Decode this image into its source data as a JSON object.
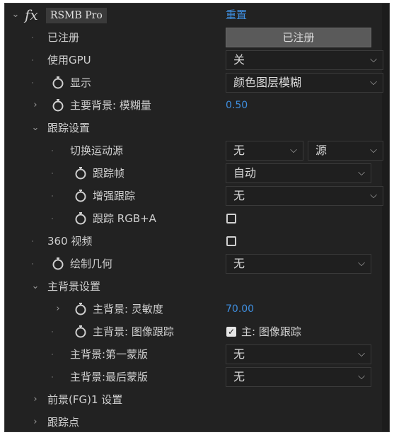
{
  "header": {
    "fx": "fx",
    "effect_name": "RSMB Pro",
    "reset_label": "重置"
  },
  "rows": {
    "registered": {
      "label": "已注册",
      "button": "已注册"
    },
    "use_gpu": {
      "label": "使用GPU",
      "value": "关"
    },
    "display": {
      "label": "显示",
      "value": "颜色图层模糊"
    },
    "main_bg_blur": {
      "label": "主要背景: 模糊量",
      "value": "0.50"
    },
    "tracking_settings": {
      "label": "跟踪设置"
    },
    "switch_motion_source": {
      "label": "切换运动源",
      "value1": "无",
      "value2": "源"
    },
    "tracking_frames": {
      "label": "跟踪帧",
      "value": "自动"
    },
    "enhance_tracking": {
      "label": "增强跟踪",
      "value": "无"
    },
    "track_rgba": {
      "label": "跟踪 RGB+A"
    },
    "video360": {
      "label": "360 视频"
    },
    "draw_geometry": {
      "label": "绘制几何",
      "value": "无"
    },
    "main_bg_settings": {
      "label": "主背景设置"
    },
    "main_bg_sensitivity": {
      "label": "主背景: 灵敏度",
      "value": "70.00"
    },
    "main_bg_image_tracking": {
      "label": "主背景: 图像跟踪",
      "checkbox_label": "主: 图像跟踪"
    },
    "main_bg_first_matte": {
      "label": "主背景:第一蒙版",
      "value": "无"
    },
    "main_bg_last_matte": {
      "label": "主背景:最后蒙版",
      "value": "无"
    },
    "foreground1_settings": {
      "label": "前景(FG)1 设置"
    },
    "tracking_points": {
      "label": "跟踪点"
    }
  },
  "colors": {
    "panel_bg": "#222222",
    "accent_blue": "#3f8fe0",
    "button_bg": "#5a5a5a"
  },
  "icons": {
    "stopwatch": "stopwatch-icon",
    "expand": "chevron-right-icon",
    "collapse": "chevron-down-icon",
    "dropdown": "chevron-down-icon",
    "checkbox": "checkbox-icon"
  }
}
